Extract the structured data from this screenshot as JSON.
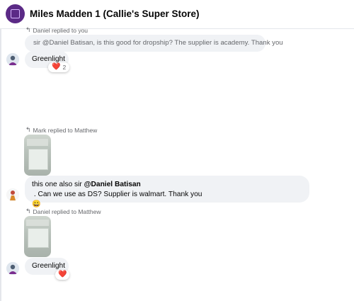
{
  "header": {
    "title": "Miles Madden 1 (Callie's Super Store)"
  },
  "messages": [
    {
      "reply_info": "Daniel replied to you",
      "quoted_text": "sir @Daniel Batisan, is this good for dropship? The supplier is academy. Thank you",
      "text": "Greenlight",
      "reaction": {
        "emoji": "❤️",
        "count": "2"
      }
    },
    {
      "reply_info": "Mark replied to Matthew",
      "text_before": "this one also sir ",
      "mention": "@Daniel Batisan",
      "text_after": " . Can we use as DS? Supplier is walmart. Thank you",
      "emoji": "😀"
    },
    {
      "reply_info": "Daniel replied to Matthew",
      "text": "Greenlight",
      "reaction": {
        "emoji": "❤️"
      }
    }
  ],
  "colors": {
    "header_avatar": "#5b2a86",
    "bubble": "#f0f2f5",
    "heart": "#e41e3f",
    "meta_text": "#65676b"
  }
}
